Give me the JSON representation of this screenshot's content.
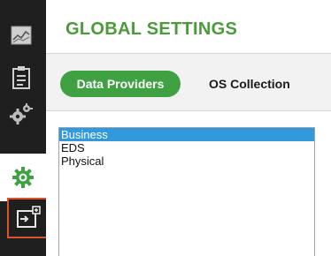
{
  "sidebar": {
    "items": [
      {
        "icon": "chart-icon"
      },
      {
        "icon": "clipboard-icon"
      },
      {
        "icon": "gears-icon"
      },
      {
        "icon": "settings-gear-icon",
        "active": true
      },
      {
        "icon": "export-window-icon",
        "highlighted": true
      }
    ]
  },
  "header": {
    "title": "GLOBAL SETTINGS"
  },
  "tabs": [
    {
      "label": "Data Providers",
      "active": true
    },
    {
      "label": "OS Collection",
      "active": false
    }
  ],
  "list": {
    "items": [
      {
        "label": "Business",
        "selected": true
      },
      {
        "label": "EDS",
        "selected": false
      },
      {
        "label": "Physical",
        "selected": false
      }
    ]
  },
  "colors": {
    "accent": "#4a9c3a",
    "tab_active": "#3fa142",
    "selection": "#3399dd",
    "sidebar_bg": "#1f1f1f",
    "highlight_outline": "#d9532b"
  }
}
